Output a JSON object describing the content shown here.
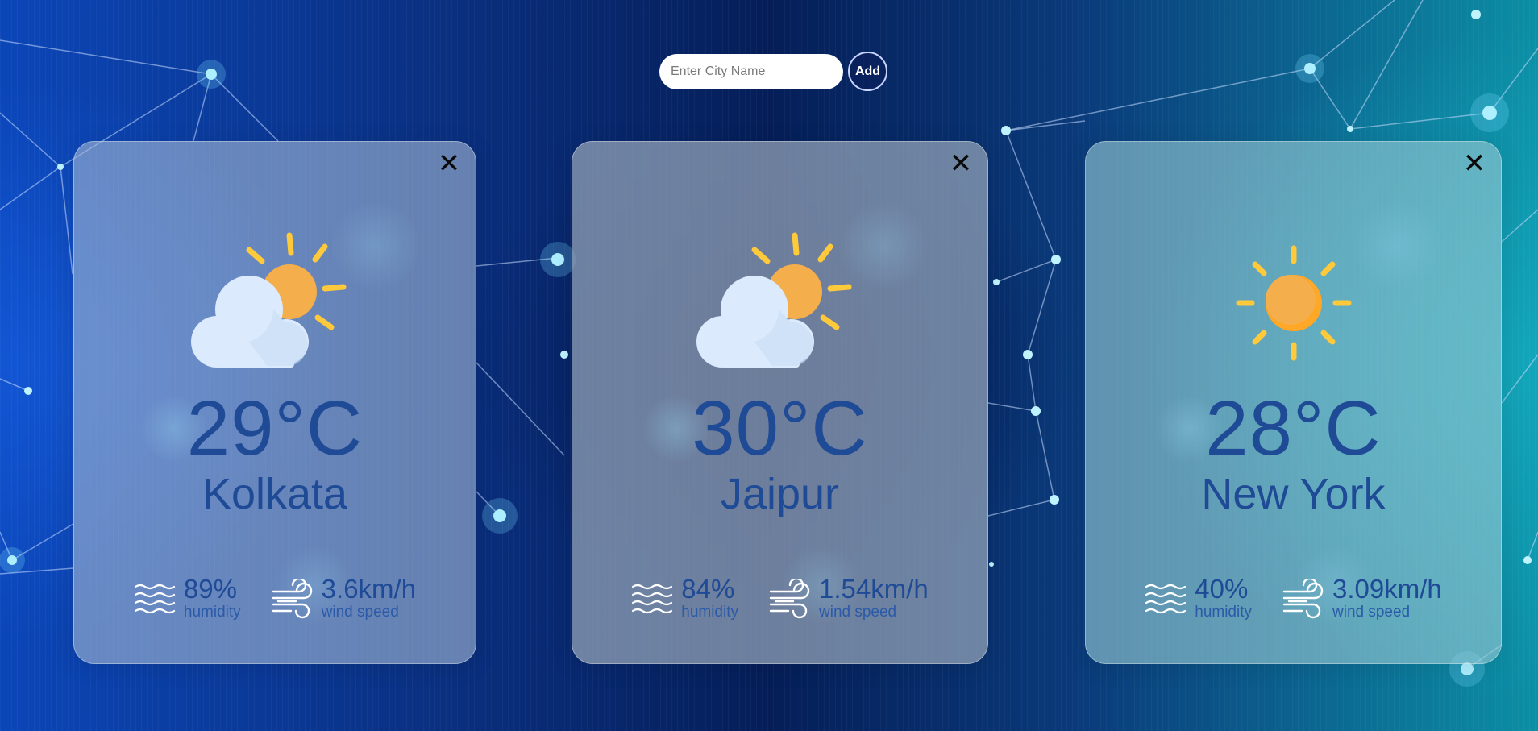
{
  "search": {
    "placeholder": "Enter City Name",
    "value": "",
    "add_label": "Add"
  },
  "cards": [
    {
      "icon": "sun-behind-cloud-icon",
      "temperature": "29°C",
      "city": "Kolkata",
      "humidity": "89%",
      "humidity_label": "humidity",
      "wind_speed": "3.6km/h",
      "wind_label": "wind speed",
      "close_label": "✕"
    },
    {
      "icon": "sun-behind-cloud-icon",
      "temperature": "30°C",
      "city": "Jaipur",
      "humidity": "84%",
      "humidity_label": "humidity",
      "wind_speed": "1.54km/h",
      "wind_label": "wind speed",
      "close_label": "✕"
    },
    {
      "icon": "sun-icon",
      "temperature": "28°C",
      "city": "New York",
      "humidity": "40%",
      "humidity_label": "humidity",
      "wind_speed": "3.09km/h",
      "wind_label": "wind speed",
      "close_label": "✕"
    }
  ],
  "colors": {
    "text_primary": "#1f4a96",
    "sun": "#f4ae4c",
    "sun_rays": "#ffc93c",
    "cloud": "#dbeafc"
  }
}
